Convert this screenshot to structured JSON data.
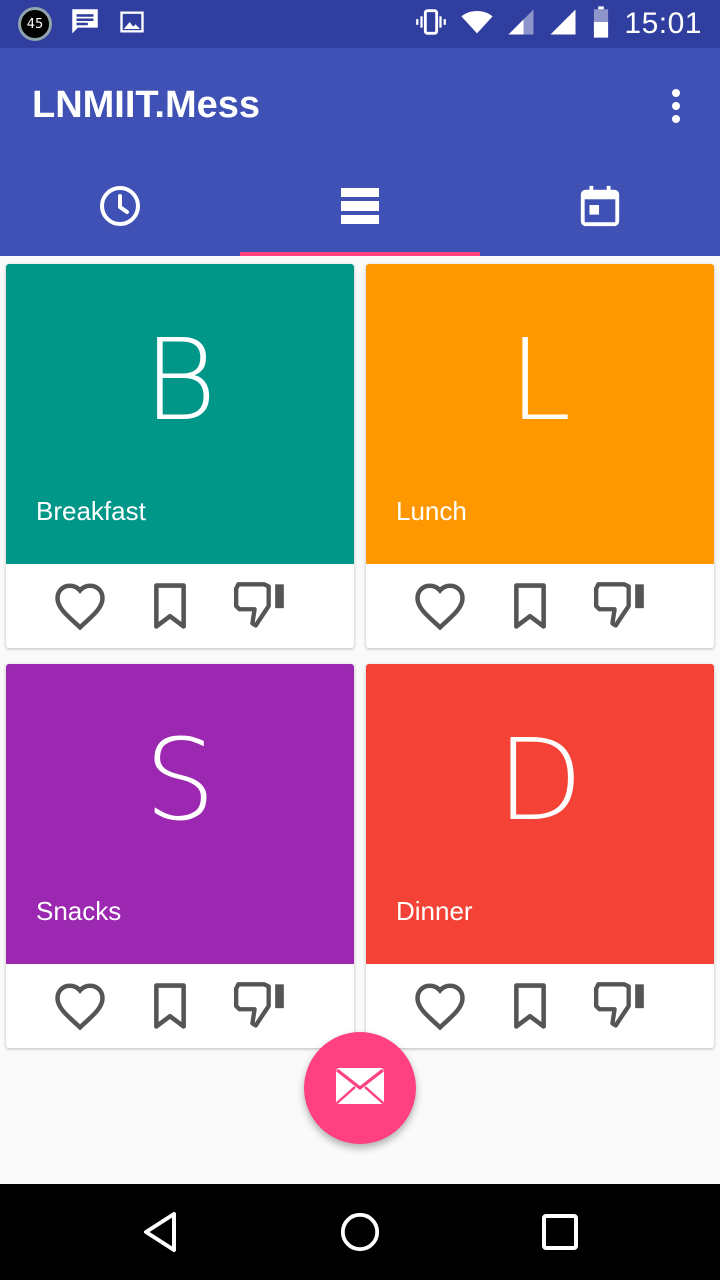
{
  "status_bar": {
    "notification_count": "45",
    "time": "15:01",
    "left_icons": [
      "count-badge",
      "message-icon",
      "image-icon"
    ],
    "right_icons": [
      "vibrate-icon",
      "wifi-icon",
      "signal-icon",
      "signal-icon",
      "battery-icon"
    ]
  },
  "app_bar": {
    "title": "LNMIIT.Mess",
    "menu_icon": "more-vert-icon"
  },
  "tabs": [
    {
      "icon": "clock-icon",
      "active": false
    },
    {
      "icon": "list-icon",
      "active": true
    },
    {
      "icon": "calendar-icon",
      "active": false
    }
  ],
  "meals": [
    {
      "letter": "B",
      "name": "Breakfast",
      "color": "#009688"
    },
    {
      "letter": "L",
      "name": "Lunch",
      "color": "#ff9800"
    },
    {
      "letter": "S",
      "name": "Snacks",
      "color": "#9c27b0"
    },
    {
      "letter": "D",
      "name": "Dinner",
      "color": "#f44336"
    }
  ],
  "card_actions": [
    "heart-icon",
    "bookmark-icon",
    "thumb-down-icon"
  ],
  "fab": {
    "icon": "mail-icon",
    "color": "#ff4081"
  },
  "nav_bar": [
    "back-icon",
    "home-icon",
    "recents-icon"
  ],
  "colors": {
    "primary": "#3f51b5",
    "primary_dark": "#303f9f",
    "accent": "#ff4081"
  }
}
